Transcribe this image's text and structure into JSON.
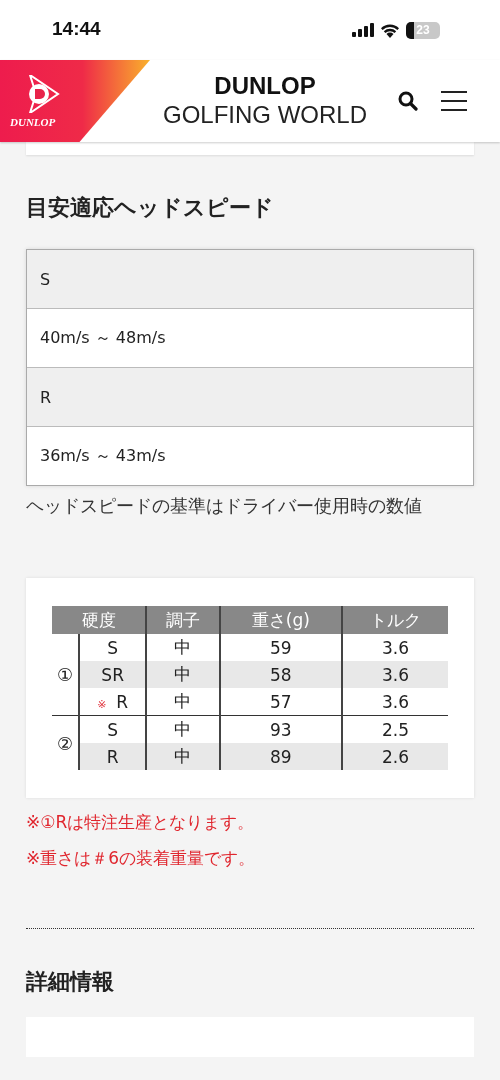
{
  "status_bar": {
    "time": "14:44",
    "battery": "23"
  },
  "header": {
    "logo_text": "DUNLOP",
    "title": "DUNLOP",
    "subtitle": "GOLFING WORLD"
  },
  "head_speed": {
    "heading": "目安適応ヘッドスピード",
    "rows": [
      {
        "kind": "label",
        "text": "S"
      },
      {
        "kind": "value",
        "text": "40m/s ～ 48m/s"
      },
      {
        "kind": "label",
        "text": "R"
      },
      {
        "kind": "value",
        "text": "36m/s ～ 43m/s"
      }
    ],
    "note": "ヘッドスピードの基準はドライバー使用時の数値"
  },
  "spec_table": {
    "columns": [
      "硬度",
      "調子",
      "重さ(g)",
      "トルク"
    ],
    "groups": [
      {
        "label": "①",
        "rows": [
          {
            "cells": [
              "S",
              "中",
              "59",
              "3.6"
            ]
          },
          {
            "cells": [
              "SR",
              "中",
              "58",
              "3.6"
            ]
          },
          {
            "mark": "※",
            "cells": [
              "R",
              "中",
              "57",
              "3.6"
            ]
          }
        ]
      },
      {
        "label": "②",
        "rows": [
          {
            "cells": [
              "S",
              "中",
              "93",
              "2.5"
            ]
          },
          {
            "cells": [
              "R",
              "中",
              "89",
              "2.6"
            ]
          }
        ]
      }
    ]
  },
  "notes": [
    "※①Rは特注生産となります。",
    "※重さは＃6の装着重量です。"
  ],
  "detail": {
    "heading": "詳細情報"
  }
}
